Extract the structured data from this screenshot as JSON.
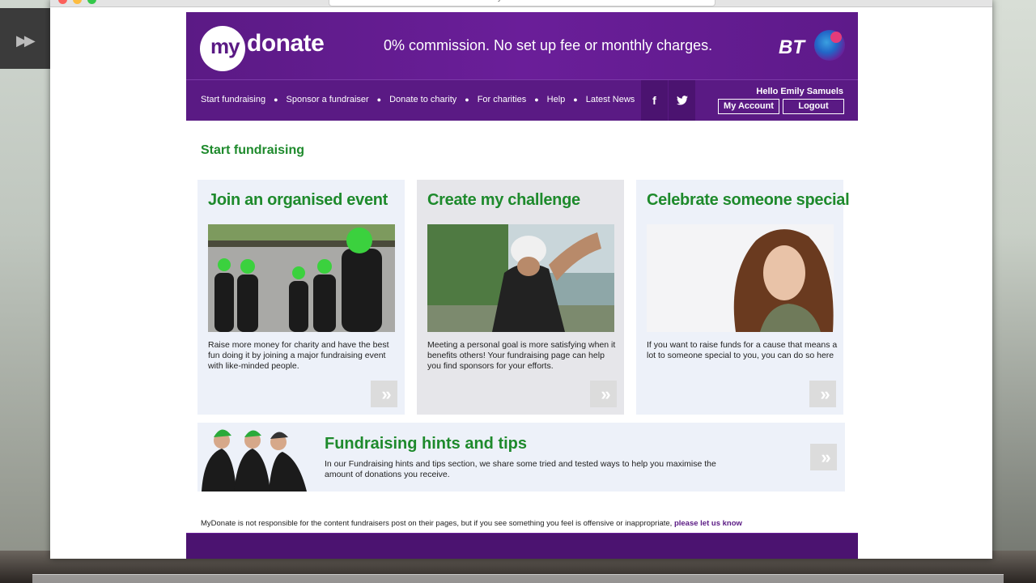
{
  "browser": {
    "url": "mydonate.bt.com"
  },
  "header": {
    "logo_my": "my",
    "logo_donate": "donate",
    "tagline": "0% commission. No set up fee or monthly charges.",
    "bt_logo": "BT"
  },
  "nav": {
    "items": [
      "Start fundraising",
      "Sponsor a fundraiser",
      "Donate to charity",
      "For charities",
      "Help",
      "Latest News"
    ],
    "facebook": "f",
    "twitter": "🐦",
    "greeting": "Hello Emily Samuels",
    "my_account": "My Account",
    "logout": "Logout"
  },
  "main": {
    "section_title": "Start fundraising",
    "cards": [
      {
        "title": "Join an organised event",
        "text": "Raise more money for charity and have the best fun doing it by joining a major fundraising event with like-minded people."
      },
      {
        "title": "Create my challenge",
        "text": "Meeting a personal goal is more satisfying when it benefits others! Your fundraising page can help you find sponsors for your efforts."
      },
      {
        "title": "Celebrate someone special",
        "text": "If you want to raise funds for a cause that means a lot to someone special to you, you can do so here"
      }
    ],
    "hints": {
      "title": "Fundraising hints and tips",
      "text": "In our Fundraising hints and tips section, we share some tried and tested ways to help you maximise the amount of donations you receive."
    },
    "arrow_glyph": "»"
  },
  "disclaimer": {
    "text": "MyDonate is not responsible for the content fundraisers post on their pages, but if you see something you feel is offensive or inappropriate,",
    "link": "please let us know"
  },
  "colors": {
    "brand_purple": "#5a1a84",
    "heading_green": "#1e8a2c"
  }
}
